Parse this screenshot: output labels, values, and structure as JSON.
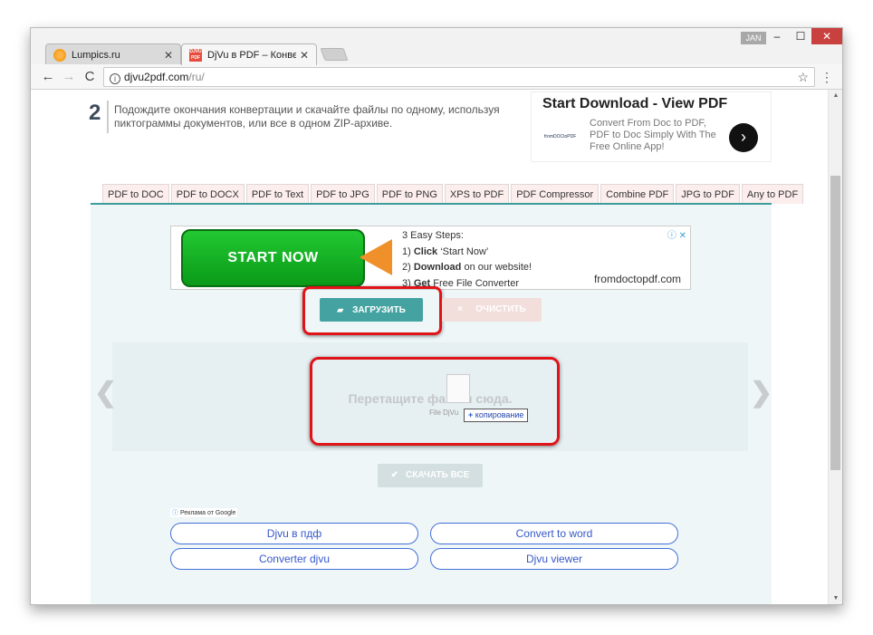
{
  "browser": {
    "tabs": [
      {
        "title": "Lumpics.ru",
        "favicon": "orange-circle-icon",
        "active": false
      },
      {
        "title": "DjVu в PDF – Конвертац",
        "favicon": "djvu-pdf-icon",
        "active": true
      }
    ],
    "user_badge": "JAN",
    "url_host": "djvu2pdf.com",
    "url_path": "/ru/",
    "window_controls": {
      "minimize": "‒",
      "maximize": "☐",
      "close": "✕"
    },
    "nav": {
      "back": "←",
      "forward": "→",
      "reload": "C"
    }
  },
  "step": {
    "number": "2",
    "text": "Подождите окончания конвертации и скачайте файлы по одному, используя пиктограммы документов, или все в одном ZIP-архиве."
  },
  "top_ad": {
    "title": "Start Download - View PDF",
    "logo_text": "fromDOCtoPDF",
    "description": "Convert From Doc to PDF, PDF to Doc Simply With The Free Online App!",
    "go_icon": "›"
  },
  "converter_tabs": [
    "PDF to DOC",
    "PDF to DOCX",
    "PDF to Text",
    "PDF to JPG",
    "PDF to PNG",
    "XPS to PDF",
    "PDF Compressor",
    "Combine PDF",
    "JPG to PDF",
    "Any to PDF"
  ],
  "mid_ad": {
    "button": "START NOW",
    "heading": "3 Easy Steps:",
    "step1_prefix": "1) ",
    "step1_bold": "Click",
    "step1_rest": " ‘Start Now’",
    "step2_prefix": "2) ",
    "step2_bold": "Download",
    "step2_rest": " on our website!",
    "step3_prefix": "3) ",
    "step3_bold": "Get",
    "step3_rest": " Free File Converter",
    "domain": "fromdoctopdf.com",
    "adchoices": "ⓘ ✕"
  },
  "actions": {
    "upload_label": "ЗАГРУЗИТЬ",
    "upload_icon": "▰",
    "clear_label": "ОЧИСТИТЬ",
    "clear_icon": "×",
    "download_all_label": "СКАЧАТЬ ВСЕ",
    "download_icon": "✔"
  },
  "dropzone": {
    "text": "Перетащите файлы сюда.",
    "drag_file_label": "File DjVu",
    "copy_badge_icon": "+",
    "copy_badge_text": "копирование",
    "prev": "❮",
    "next": "❯"
  },
  "ad_links": {
    "label_icon": "ⓘ",
    "label": "Реклама от Google",
    "links": [
      "Djvu в пдф",
      "Convert to word",
      "Converter djvu",
      "Djvu viewer"
    ]
  },
  "colors": {
    "accent_teal": "#44a3a1",
    "highlight_red": "#e01418",
    "tab_bg": "#fdeeee",
    "link_blue": "#3559c9"
  }
}
